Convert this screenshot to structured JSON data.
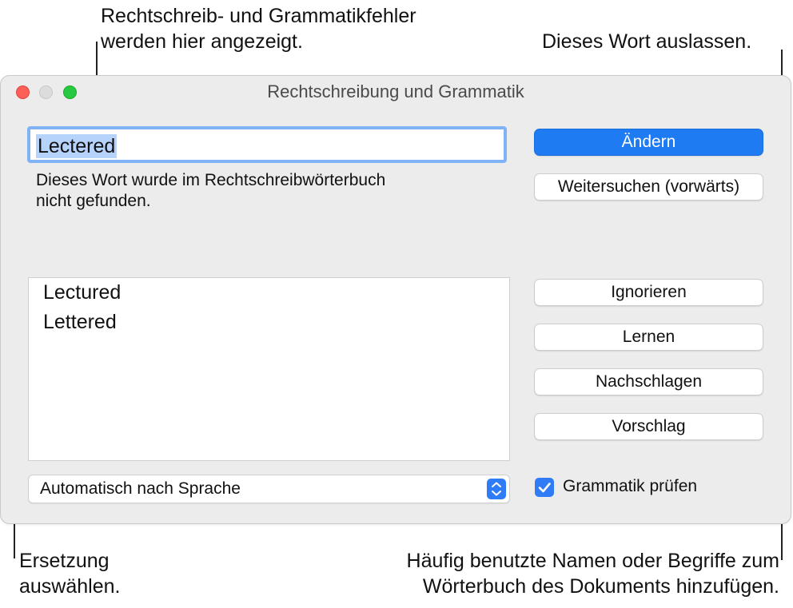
{
  "callouts": {
    "top_left": [
      "Rechtschreib- und Grammatikfehler",
      "werden hier angezeigt."
    ],
    "top_right": "Dieses Wort auslassen.",
    "bottom_left": [
      "Ersetzung",
      "auswählen."
    ],
    "bottom_right": [
      "Häufig benutzte Namen oder Begriffe zum",
      "Wörterbuch des Dokuments hinzufügen."
    ]
  },
  "window": {
    "title": "Rechtschreibung und Grammatik",
    "misspelled_word": "Lectered",
    "description": [
      "Dieses Wort wurde im Rechtschreibwörterbuch",
      "nicht gefunden."
    ],
    "suggestions": [
      "Lectured",
      "Lettered"
    ],
    "language_select": "Automatisch nach Sprache",
    "buttons": {
      "change": "Ändern",
      "find_next": "Weitersuchen (vorwärts)",
      "ignore": "Ignorieren",
      "learn": "Lernen",
      "look_up": "Nachschlagen",
      "guess": "Vorschlag"
    },
    "grammar_check": {
      "label": "Grammatik prüfen",
      "checked": true
    }
  },
  "colors": {
    "accent": "#1f7bf2",
    "selection": "#b6d3fb",
    "focus_ring": "#7fb3f5"
  },
  "icons": [
    "close-icon",
    "minimize-icon",
    "zoom-icon",
    "select-stepper-icon",
    "checkmark-icon"
  ]
}
